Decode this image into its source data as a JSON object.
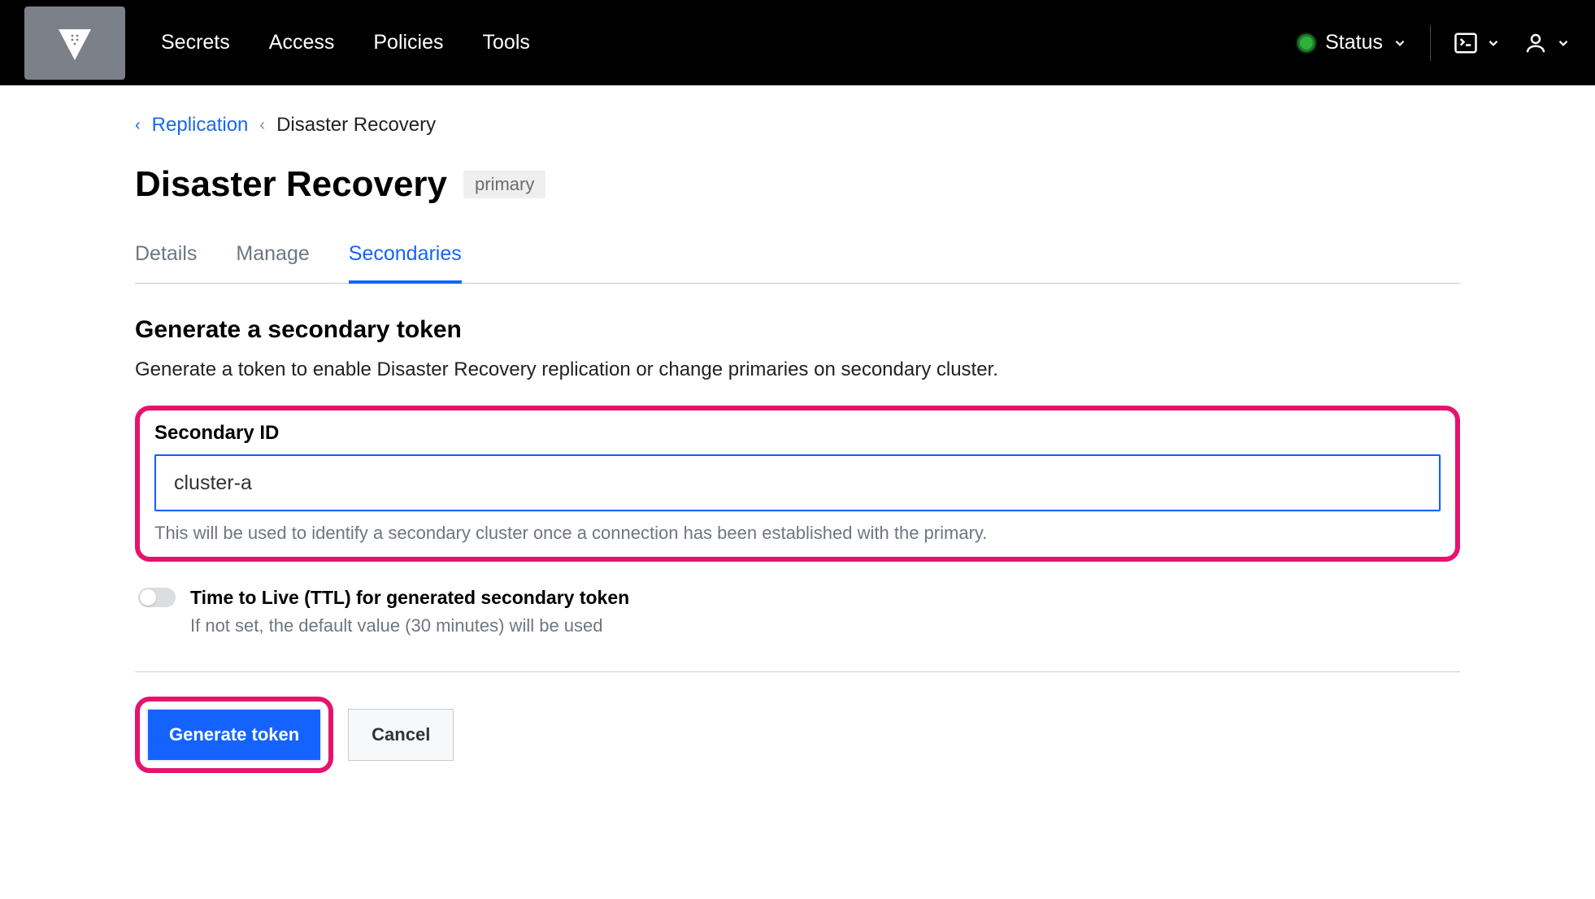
{
  "nav": {
    "items": [
      "Secrets",
      "Access",
      "Policies",
      "Tools"
    ],
    "status_label": "Status"
  },
  "breadcrumb": {
    "parent": "Replication",
    "current": "Disaster Recovery"
  },
  "page": {
    "title": "Disaster Recovery",
    "badge": "primary"
  },
  "tabs": {
    "items": [
      "Details",
      "Manage",
      "Secondaries"
    ],
    "active_index": 2
  },
  "section": {
    "title": "Generate a secondary token",
    "desc": "Generate a token to enable Disaster Recovery replication or change primaries on secondary cluster."
  },
  "secondary_id": {
    "label": "Secondary ID",
    "value": "cluster-a",
    "hint": "This will be used to identify a secondary cluster once a connection has been established with the primary."
  },
  "ttl": {
    "title": "Time to Live (TTL) for generated secondary token",
    "desc": "If not set, the default value (30 minutes) will be used",
    "enabled": false
  },
  "actions": {
    "generate": "Generate token",
    "cancel": "Cancel"
  }
}
